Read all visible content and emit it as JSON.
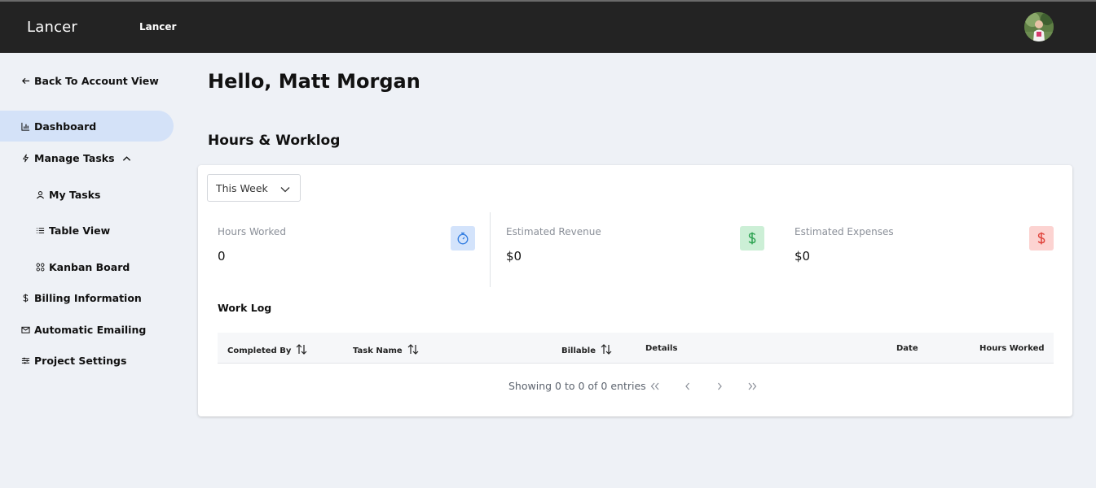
{
  "header": {
    "brand": "Lancer",
    "nav_label": "Lancer",
    "avatar_icon": "user-avatar"
  },
  "sidebar": {
    "back_label": "Back To Account View",
    "items": [
      {
        "label": "Dashboard",
        "icon": "bar-chart-icon",
        "active": true
      },
      {
        "label": "Manage Tasks",
        "icon": "lightning-icon"
      },
      {
        "label": "My Tasks",
        "icon": "user-icon"
      },
      {
        "label": "Table View",
        "icon": "list-icon"
      },
      {
        "label": "Kanban Board",
        "icon": "grid-icon"
      },
      {
        "label": "Billing Information",
        "icon": "dollar-icon"
      },
      {
        "label": "Automatic Emailing",
        "icon": "mail-icon"
      },
      {
        "label": "Project Settings",
        "icon": "settings-icon"
      }
    ]
  },
  "main": {
    "greeting": "Hello, Matt Morgan",
    "section_title": "Hours & Worklog",
    "period_select": {
      "value": "This Week"
    },
    "stats": [
      {
        "label": "Hours Worked",
        "value": "0",
        "icon": "stopwatch-icon",
        "color": "#2f7be0",
        "bg": "#d3e3fb"
      },
      {
        "label": "Estimated Revenue",
        "value": "$0",
        "icon": "dollar-icon",
        "color": "#2ea352",
        "bg": "#ccefd6"
      },
      {
        "label": "Estimated Expenses",
        "value": "$0",
        "icon": "dollar-icon",
        "color": "#e0443c",
        "bg": "#fcd3d1"
      }
    ],
    "worklog": {
      "title": "Work Log",
      "columns": [
        "Completed By",
        "Task Name",
        "Billable",
        "Details",
        "Date",
        "Hours Worked"
      ],
      "pagination_text": "Showing 0 to 0 of 0 entries"
    }
  },
  "colors": {
    "topbar": "#232323",
    "background": "#eef1f6",
    "active_item": "#d4e2f8"
  }
}
